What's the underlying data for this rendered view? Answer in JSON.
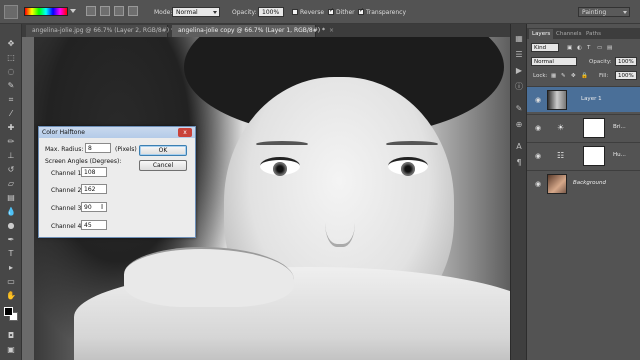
{
  "options_bar": {
    "mode_label": "Mode:",
    "mode_value": "Normal",
    "opacity_label": "Opacity:",
    "opacity_value": "100%",
    "reverse_label": "Reverse",
    "dither_label": "Dither",
    "transparency_label": "Transparency",
    "workspace_value": "Painting"
  },
  "tabs": [
    {
      "label": "angelina-jolie.jpg @ 66.7% (Layer 2, RGB/8#) *",
      "close": "×"
    },
    {
      "label": "angelina-jolie copy @ 66.7% (Layer 1, RGB/8#) *",
      "close": "×"
    }
  ],
  "dialog": {
    "title": "Color Halftone",
    "close": "x",
    "max_radius_label": "Max. Radius:",
    "max_radius_value": "8",
    "pixels_label": "(Pixels)",
    "screen_angles_label": "Screen Angles (Degrees):",
    "channels": [
      {
        "label": "Channel 1:",
        "value": "108"
      },
      {
        "label": "Channel 2:",
        "value": "162"
      },
      {
        "label": "Channel 3:",
        "value": "90"
      },
      {
        "label": "Channel 4:",
        "value": "45"
      }
    ],
    "ok_label": "OK",
    "cancel_label": "Cancel"
  },
  "panel": {
    "tabs": [
      "Layers",
      "Channels",
      "Paths"
    ],
    "kind_label": "Kind",
    "blend_value": "Normal",
    "opacity_label": "Opacity:",
    "opacity_value": "100%",
    "lock_label": "Lock:",
    "fill_label": "Fill:",
    "fill_value": "100%",
    "layers": [
      {
        "name": "Layer 1"
      },
      {
        "name": "Bri..."
      },
      {
        "name": "Hu..."
      },
      {
        "name": "Background"
      }
    ]
  },
  "colors": {
    "accent": "#4a6f98",
    "dialog_title": "#b4cbe8"
  }
}
